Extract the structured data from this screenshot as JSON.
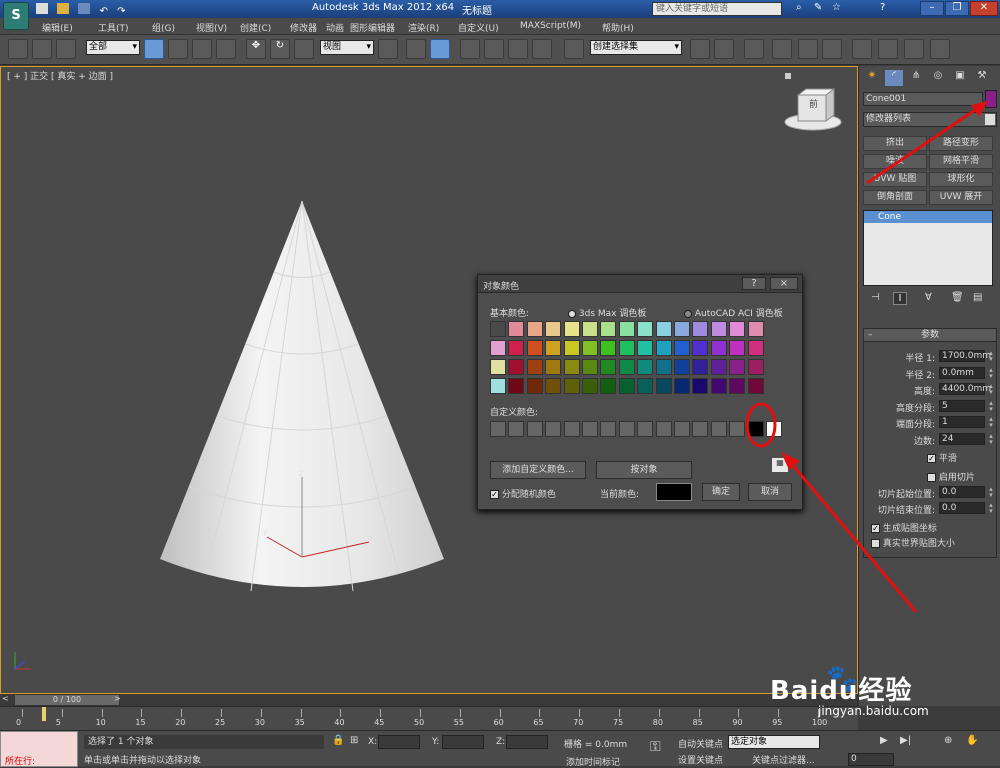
{
  "window": {
    "title": "Autodesk 3ds Max  2012 x64",
    "doc": "无标题",
    "search_placeholder": "键入关键字或短语"
  },
  "menu": [
    "编辑(E)",
    "工具(T)",
    "组(G)",
    "视图(V)",
    "创建(C)",
    "修改器",
    "动画",
    "图形编辑器",
    "渲染(R)",
    "自定义(U)",
    "MAXScript(M)",
    "帮助(H)"
  ],
  "toolbar": {
    "selection_filter": "全部",
    "coord_system": "视图",
    "named_selection": "创建选择集"
  },
  "viewport": {
    "label": "[ + ] 正交 [ 真实 + 边面 ]",
    "axis_x": "x",
    "axis_y": "y",
    "axis_z": "z",
    "cube_label": "前"
  },
  "panel": {
    "object_name": "Cone001",
    "object_color": "#8a1f8a",
    "modifier_list": "修改器列表",
    "mod_buttons": [
      "挤出",
      "路径变形",
      "噪波",
      "网格平滑",
      "UVW 贴图",
      "球形化",
      "倒角剖面",
      "UVW 展开"
    ],
    "stack_item": "Cone",
    "rollout_title": "参数",
    "params": [
      {
        "label": "半径 1:",
        "value": "1700.0mm"
      },
      {
        "label": "半径 2:",
        "value": "0.0mm"
      },
      {
        "label": "高度:",
        "value": "4400.0mm"
      },
      {
        "label": "高度分段:",
        "value": "5"
      },
      {
        "label": "端面分段:",
        "value": "1"
      },
      {
        "label": "边数:",
        "value": "24"
      }
    ],
    "smooth": "平滑",
    "slice_on": "启用切片",
    "slice_from": "切片起始位置:",
    "slice_to": "切片结束位置:",
    "slice_from_val": "0.0",
    "slice_to_val": "0.0",
    "gen_map": "生成贴图坐标",
    "real_world": "真实世界贴图大小"
  },
  "dialog": {
    "title": "对象颜色",
    "help": "?",
    "close": "×",
    "basic_label": "基本颜色:",
    "palette_3ds": "3ds Max 调色板",
    "palette_acad": "AutoCAD ACI 调色板",
    "custom_label": "自定义颜色:",
    "add_custom": "添加自定义颜色...",
    "by_object": "按对象",
    "assign_random": "分配随机颜色",
    "current_color_label": "当前颜色:",
    "current_color": "#000000",
    "ok": "确定",
    "cancel": "取消",
    "basic_colors": [
      [
        "#4a4a4a",
        "#e08a9a",
        "#e8a888",
        "#e8c88a",
        "#e8e28a",
        "#c8e08a",
        "#a8e08a",
        "#8ae0a0",
        "#8ae0c8",
        "#8ad0e0",
        "#8aa8e0",
        "#a08ae0",
        "#c08ae0",
        "#e08ad8",
        "#e08aac"
      ],
      [
        "#e0a0d0",
        "#d02050",
        "#d05020",
        "#d0a020",
        "#c8c820",
        "#80c020",
        "#40c020",
        "#20c060",
        "#20c0a0",
        "#20a0c0",
        "#2060d0",
        "#5030d0",
        "#9030d0",
        "#c030c0",
        "#d03080"
      ],
      [
        "#e0e0a0",
        "#a01030",
        "#a04010",
        "#a07a10",
        "#8a8a10",
        "#5a8a10",
        "#208a20",
        "#108a4a",
        "#108a7a",
        "#10708a",
        "#10409a",
        "#30209a",
        "#60209a",
        "#8a208a",
        "#9a2060"
      ],
      [
        "#a0e0e0",
        "#700818",
        "#702808",
        "#705008",
        "#606008",
        "#3a6008",
        "#106010",
        "#086030",
        "#086058",
        "#084860",
        "#082870",
        "#180870",
        "#400870",
        "#600860",
        "#700838"
      ]
    ],
    "custom_colors": [
      "#666666",
      "#666666",
      "#666666",
      "#666666",
      "#666666",
      "#666666",
      "#666666",
      "#666666",
      "#666666",
      "#666666",
      "#666666",
      "#666666",
      "#666666",
      "#666666",
      "#000000",
      "#ffffff"
    ]
  },
  "timeline": {
    "frame": "0 / 100",
    "ticks": [
      "0",
      "5",
      "10",
      "15",
      "20",
      "25",
      "30",
      "35",
      "40",
      "45",
      "50",
      "55",
      "60",
      "65",
      "70",
      "75",
      "80",
      "85",
      "90",
      "95",
      "100"
    ]
  },
  "status": {
    "selected": "选择了 1 个对象",
    "hint": "单击或单击并拖动以选择对象",
    "current": "所在行:",
    "x_label": "X:",
    "y_label": "Y:",
    "z_label": "Z:",
    "grid": "栅格 = 0.0mm",
    "add_tag": "添加时间标记",
    "auto_key": "自动关键点",
    "set_key": "设置关键点",
    "sel_obj": "选定对象",
    "key_filter": "关键点过滤器...",
    "frame_val": "0"
  },
  "watermark": {
    "brand": "Baidu经验",
    "url": "jingyan.baidu.com"
  }
}
